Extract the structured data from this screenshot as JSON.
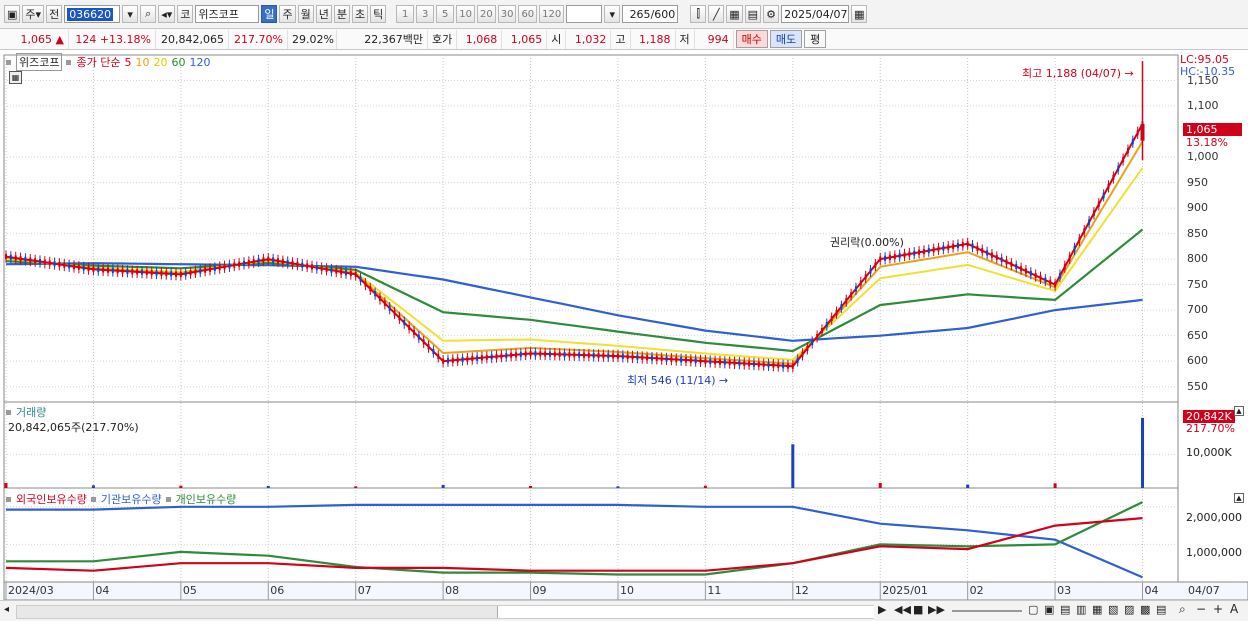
{
  "toolbar": {
    "market": "주",
    "prev_label": "전",
    "stock_code": "036620",
    "exchange": "코",
    "stock_name": "위즈코프",
    "periods": [
      "일",
      "주",
      "월",
      "년",
      "분",
      "초",
      "틱"
    ],
    "selected_period": "일",
    "intervals": [
      "1",
      "3",
      "5",
      "10",
      "20",
      "30",
      "60",
      "120"
    ],
    "count": "265",
    "count_total": "/600",
    "date": "2025/04/07"
  },
  "quote": {
    "price": "1,065",
    "change": "124",
    "change_rate": "+13.18%",
    "volume": "20,842,065",
    "volume_ratio": "217.70%",
    "turnover": "29.02%",
    "amount": "22,367백만",
    "bid_label": "호가",
    "bid1": "1,068",
    "bid2": "1,065",
    "open_label": "시",
    "open": "1,032",
    "high_label": "고",
    "high": "1,188",
    "low_label": "저",
    "low": "994",
    "buy_label": "매수",
    "sell_label": "매도",
    "eval_label": "평"
  },
  "price_panel": {
    "name_tag": "위즈코프",
    "ma_label": "종가 단순",
    "ma_periods": [
      "5",
      "10",
      "20",
      "60",
      "120"
    ],
    "ma_colors": [
      "#d0021b",
      "#e8a21a",
      "#f0e030",
      "#2e8b3a",
      "#2f5fd0"
    ],
    "lc": "LC:95.05",
    "hc": "HC:-10.35",
    "current_price": "1,065",
    "current_rate": "13.18%",
    "high_annotation": "최고 1,188 (04/07)",
    "low_annotation": "최저 546 (11/14)",
    "event_annotation": "권리락(0.00%)",
    "y_ticks": [
      "1,150",
      "1,100",
      "1,000",
      "950",
      "900",
      "850",
      "800",
      "750",
      "700",
      "650",
      "600",
      "550"
    ]
  },
  "volume_panel": {
    "title": "거래량",
    "value_text": "20,842,065주(217.70%)",
    "current": "20,842K",
    "current_rate": "217.70%",
    "y_tick": "10,000K"
  },
  "holding_panel": {
    "series": [
      "외국인보유수량",
      "기관보유수량",
      "개인보유수량"
    ],
    "colors": [
      "#d0021b",
      "#2f5fd0",
      "#2e8b3a"
    ],
    "y_ticks": [
      "2,000,000",
      "1,000,000"
    ]
  },
  "x_axis": [
    "2024/03",
    "04",
    "05",
    "06",
    "07",
    "08",
    "09",
    "10",
    "11",
    "12",
    "2025/01",
    "02",
    "03",
    "04",
    "04/07"
  ],
  "chart_data": [
    {
      "type": "line",
      "title": "위즈코프 종가 단순",
      "x": [
        "2024/03",
        "04",
        "05",
        "06",
        "07",
        "08",
        "09",
        "10",
        "11",
        "12",
        "2025/01",
        "02",
        "03",
        "04/07"
      ],
      "series": [
        {
          "name": "5",
          "values": [
            805,
            780,
            770,
            800,
            770,
            600,
            615,
            610,
            600,
            590,
            800,
            830,
            750,
            1065
          ]
        },
        {
          "name": "120",
          "values": [
            790,
            792,
            790,
            788,
            785,
            760,
            725,
            690,
            660,
            640,
            650,
            665,
            700,
            720
          ]
        }
      ],
      "ylim": [
        520,
        1200
      ]
    },
    {
      "type": "bar",
      "title": "거래량",
      "categories": [
        "2024/03",
        "04",
        "05",
        "06",
        "07",
        "08",
        "09",
        "10",
        "11",
        "12",
        "2025/01",
        "02",
        "03",
        "04/07"
      ],
      "values": [
        1500,
        800,
        700,
        600,
        500,
        900,
        600,
        500,
        700,
        13000,
        1500,
        1000,
        1400,
        20842
      ]
    }
  ]
}
